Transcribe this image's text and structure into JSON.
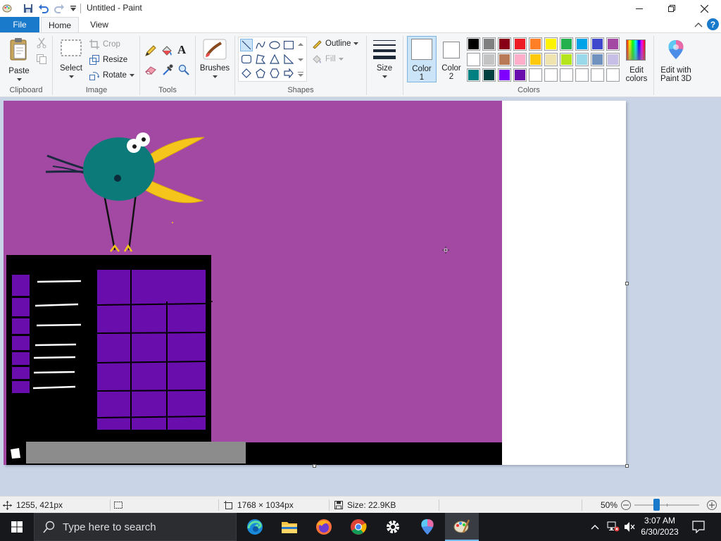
{
  "window": {
    "title": "Untitled - Paint"
  },
  "tabs": [
    {
      "label": "File"
    },
    {
      "label": "Home"
    },
    {
      "label": "View"
    }
  ],
  "ribbon": {
    "clipboard": {
      "paste": "Paste",
      "group": "Clipboard"
    },
    "image": {
      "select": "Select",
      "crop": "Crop",
      "resize": "Resize",
      "rotate": "Rotate",
      "group": "Image"
    },
    "tools": {
      "group": "Tools"
    },
    "shapes": {
      "outline": "Outline",
      "fill": "Fill",
      "group": "Shapes"
    },
    "brushes": {
      "label": "Brushes"
    },
    "size": {
      "label": "Size"
    },
    "colors": {
      "color1_a": "Color",
      "color1_b": "1",
      "color2_a": "Color",
      "color2_b": "2",
      "edit_a": "Edit",
      "edit_b": "colors",
      "paint3d_a": "Edit with",
      "paint3d_b": "Paint 3D",
      "group": "Colors",
      "color1": "#ffffff",
      "color2": "#ffffff",
      "palette_row1": [
        "#000000",
        "#7f7f7f",
        "#880015",
        "#ed1c24",
        "#ff7f27",
        "#fff200",
        "#22b14c",
        "#00a2e8",
        "#3f48cc",
        "#a349a4"
      ],
      "palette_row2": [
        "#ffffff",
        "#c3c3c3",
        "#b97a57",
        "#ffaec9",
        "#ffc90e",
        "#efe4b0",
        "#b5e61d",
        "#99d9ea",
        "#7092be",
        "#c8bfe7"
      ],
      "palette_row3": [
        "#008080",
        "#004040",
        "#8000ff",
        "#6a0dad",
        "#ffffff",
        "#ffffff",
        "#ffffff",
        "#ffffff",
        "#ffffff",
        "#ffffff"
      ]
    }
  },
  "canvas": {
    "background": "#a349a4",
    "accent": "#6a0dad"
  },
  "status": {
    "cursor_pos": "1255, 421px",
    "canvas_size": "1768 × 1034px",
    "file_size": "Size: 22.9KB",
    "zoom": "50%",
    "zoom_fraction": 0.5
  },
  "taskbar": {
    "search_placeholder": "Type here to search",
    "time": "3:07 AM",
    "date": "6/30/2023"
  }
}
